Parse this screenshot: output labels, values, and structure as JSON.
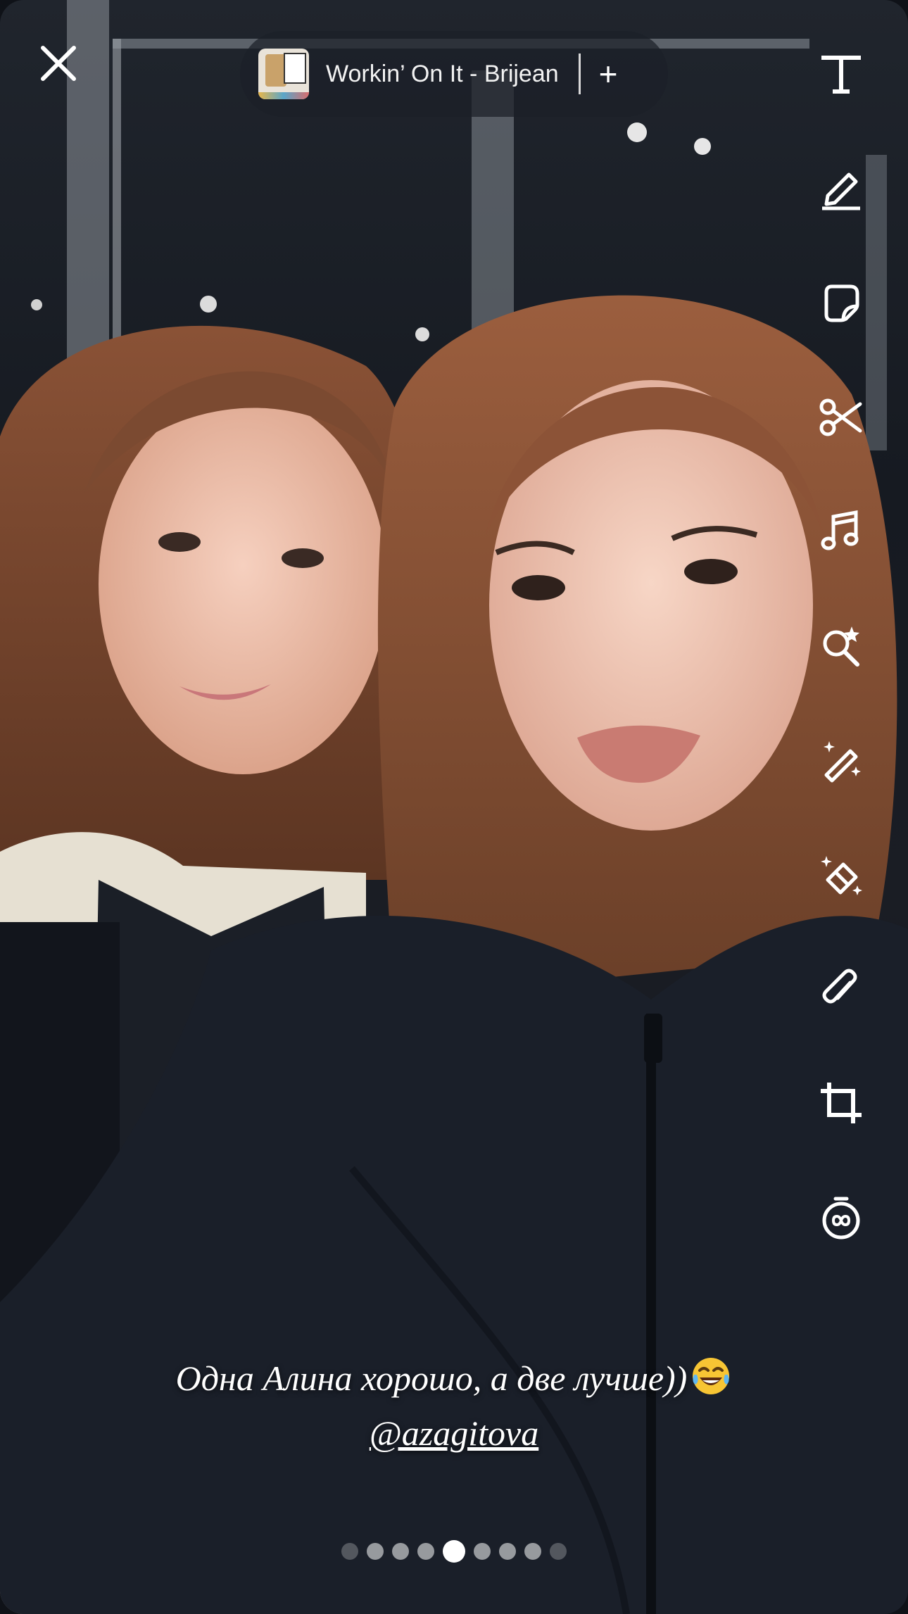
{
  "music": {
    "title": "Workin’ On It - Brijean",
    "add_symbol": "+"
  },
  "caption": {
    "line1": "Одна Алина хорошо, а две лучше))",
    "mention": "@azagitova"
  },
  "toolbar": {
    "items": [
      {
        "icon": "text-icon"
      },
      {
        "icon": "pencil-icon"
      },
      {
        "icon": "sticker-icon"
      },
      {
        "icon": "scissors-icon"
      },
      {
        "icon": "music-note-icon"
      },
      {
        "icon": "lens-search-icon"
      },
      {
        "icon": "magic-wand-icon"
      },
      {
        "icon": "magic-eraser-icon"
      },
      {
        "icon": "paperclip-icon"
      },
      {
        "icon": "crop-icon"
      },
      {
        "icon": "timer-icon"
      }
    ]
  },
  "pagination": {
    "count": 9,
    "active_index": 4
  },
  "colors": {
    "accent": "#ffffff",
    "pill_bg": "#1c2028"
  }
}
